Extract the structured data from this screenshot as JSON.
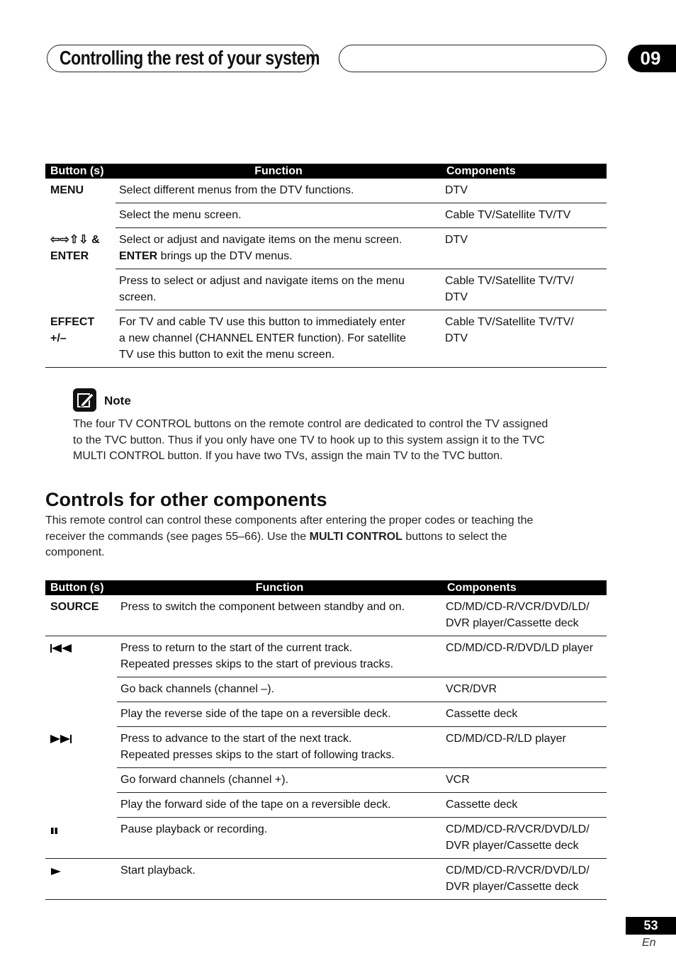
{
  "header": {
    "title": "Controlling the rest of your system",
    "chapter": "09"
  },
  "table1": {
    "headers": [
      "Button (s)",
      "Function",
      "Components"
    ],
    "groups": [
      {
        "button": "MENU",
        "rows": [
          {
            "function": [
              {
                "t": "Select different menus from the DTV functions."
              }
            ],
            "components": "DTV"
          },
          {
            "function": [
              {
                "t": "Select the menu screen."
              }
            ],
            "components": "Cable TV/Satellite TV/TV"
          }
        ]
      },
      {
        "button": "⇦⇨⇧⇩ &\nENTER",
        "rows": [
          {
            "function": [
              {
                "t": "Select or adjust and navigate items on the menu screen.\n"
              },
              {
                "t": "ENTER",
                "b": true
              },
              {
                "t": " brings up the DTV menus."
              }
            ],
            "components": "DTV"
          },
          {
            "function": [
              {
                "t": "Press to select or adjust and navigate items on the menu\nscreen."
              }
            ],
            "components": "Cable TV/Satellite TV/TV/\nDTV"
          }
        ]
      },
      {
        "button": "EFFECT\n+/–",
        "rows": [
          {
            "function": [
              {
                "t": "For TV  and cable TV use this button to immediately enter\na new channel (CHANNEL ENTER function). For satellite\nTV use this button to exit the menu screen."
              }
            ],
            "components": "Cable TV/Satellite TV/TV/\nDTV"
          }
        ]
      }
    ]
  },
  "note": {
    "icon": "pencil-note-icon",
    "label": "Note",
    "text": "The four TV CONTROL buttons on the remote control are dedicated to control the TV assigned\nto the TVC button. Thus if you only have one TV to hook up to this system assign it to the TVC\nMULTI CONTROL button. If you have two TVs, assign the main TV to the TVC button."
  },
  "section": {
    "heading": "Controls for other components",
    "intro": [
      {
        "t": "This remote control can control these components after entering the proper codes or teaching the\nreceiver the commands (see pages 55–66). Use the "
      },
      {
        "t": "MULTI CONTROL",
        "b": true
      },
      {
        "t": " buttons to select the\ncomponent."
      }
    ]
  },
  "table2": {
    "headers": [
      "Button (s)",
      "Function",
      "Components"
    ],
    "groups": [
      {
        "button": "SOURCE",
        "rows": [
          {
            "function": [
              {
                "t": "Press to switch the component between standby and on."
              }
            ],
            "components": "CD/MD/CD-R/VCR/DVD/LD/\nDVR player/Cassette deck"
          }
        ]
      },
      {
        "button": "",
        "icon": "previous-track-icon",
        "rows": [
          {
            "function": [
              {
                "t": "Press to return to the start of the current track.\nRepeated presses skips to the start of previous tracks."
              }
            ],
            "components": "CD/MD/CD-R/DVD/LD player"
          },
          {
            "function": [
              {
                "t": "Go back channels (channel –)."
              }
            ],
            "components": "VCR/DVR"
          },
          {
            "function": [
              {
                "t": "Play the reverse side of the tape on a reversible deck."
              }
            ],
            "components": "Cassette deck"
          }
        ]
      },
      {
        "button": "",
        "icon": "next-track-icon",
        "rows": [
          {
            "function": [
              {
                "t": "Press to advance to the start of the next track.\nRepeated presses skips to the start of following tracks."
              }
            ],
            "components": "CD/MD/CD-R/LD player"
          },
          {
            "function": [
              {
                "t": "Go forward channels (channel +)."
              }
            ],
            "components": "VCR"
          },
          {
            "function": [
              {
                "t": "Play the forward side of the tape on a reversible deck."
              }
            ],
            "components": "Cassette deck"
          }
        ]
      },
      {
        "button": "",
        "icon": "pause-icon",
        "rows": [
          {
            "function": [
              {
                "t": "Pause playback or recording."
              }
            ],
            "components": "CD/MD/CD-R/VCR/DVD/LD/\nDVR player/Cassette deck"
          }
        ]
      },
      {
        "button": "",
        "icon": "play-icon",
        "rows": [
          {
            "function": [
              {
                "t": "Start playback."
              }
            ],
            "components": "CD/MD/CD-R/VCR/DVD/LD/\nDVR player/Cassette deck"
          }
        ]
      }
    ]
  },
  "footer": {
    "page": "53",
    "lang": "En"
  }
}
